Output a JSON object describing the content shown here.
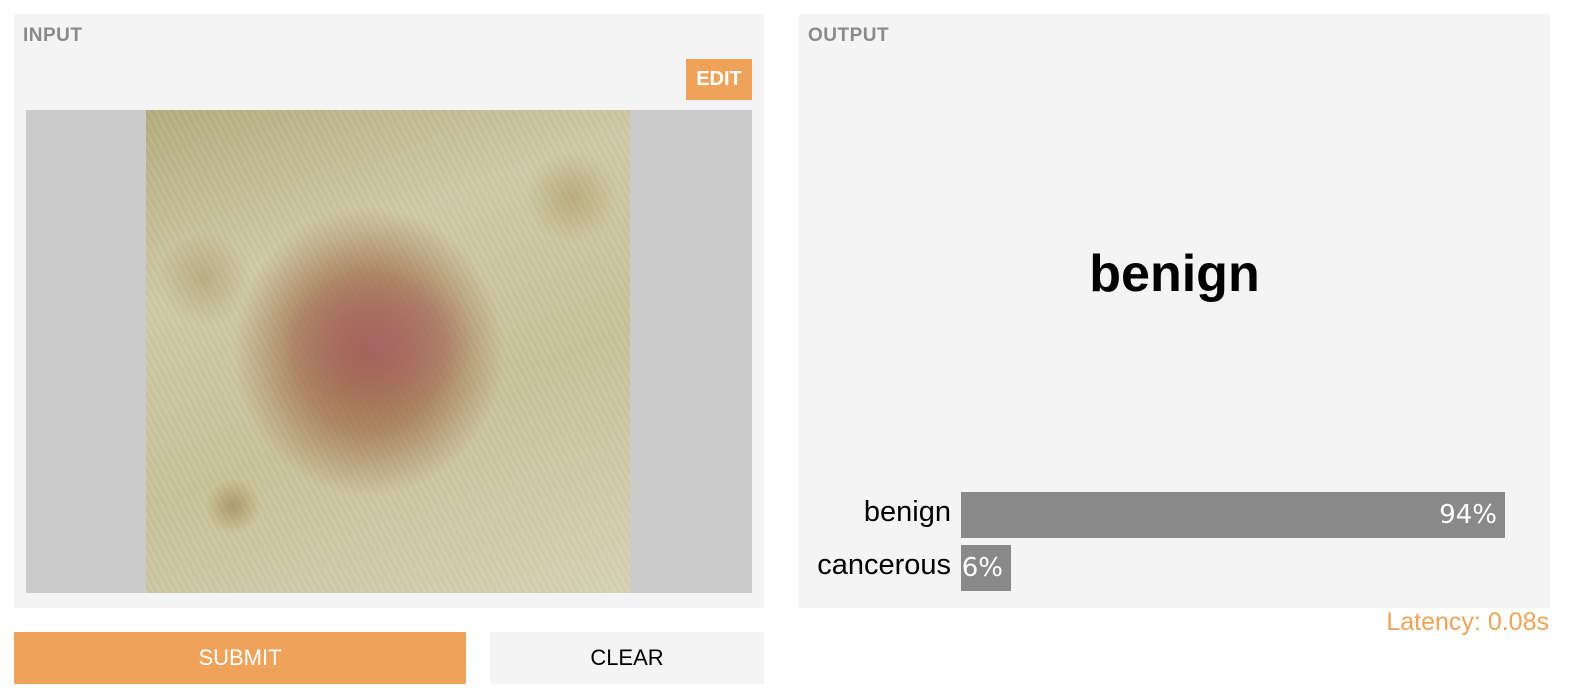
{
  "input": {
    "title": "INPUT",
    "edit_label": "EDIT"
  },
  "actions": {
    "submit_label": "SUBMIT",
    "clear_label": "CLEAR"
  },
  "output": {
    "title": "OUTPUT",
    "prediction": "benign",
    "confidences": [
      {
        "label": "benign",
        "value": 0.94,
        "display": "94%"
      },
      {
        "label": "cancerous",
        "value": 0.06,
        "display": "6%"
      }
    ]
  },
  "latency_text": "Latency: 0.08s",
  "colors": {
    "accent": "#efa35a",
    "panel_bg": "#f4f4f4",
    "bar": "#898989"
  }
}
